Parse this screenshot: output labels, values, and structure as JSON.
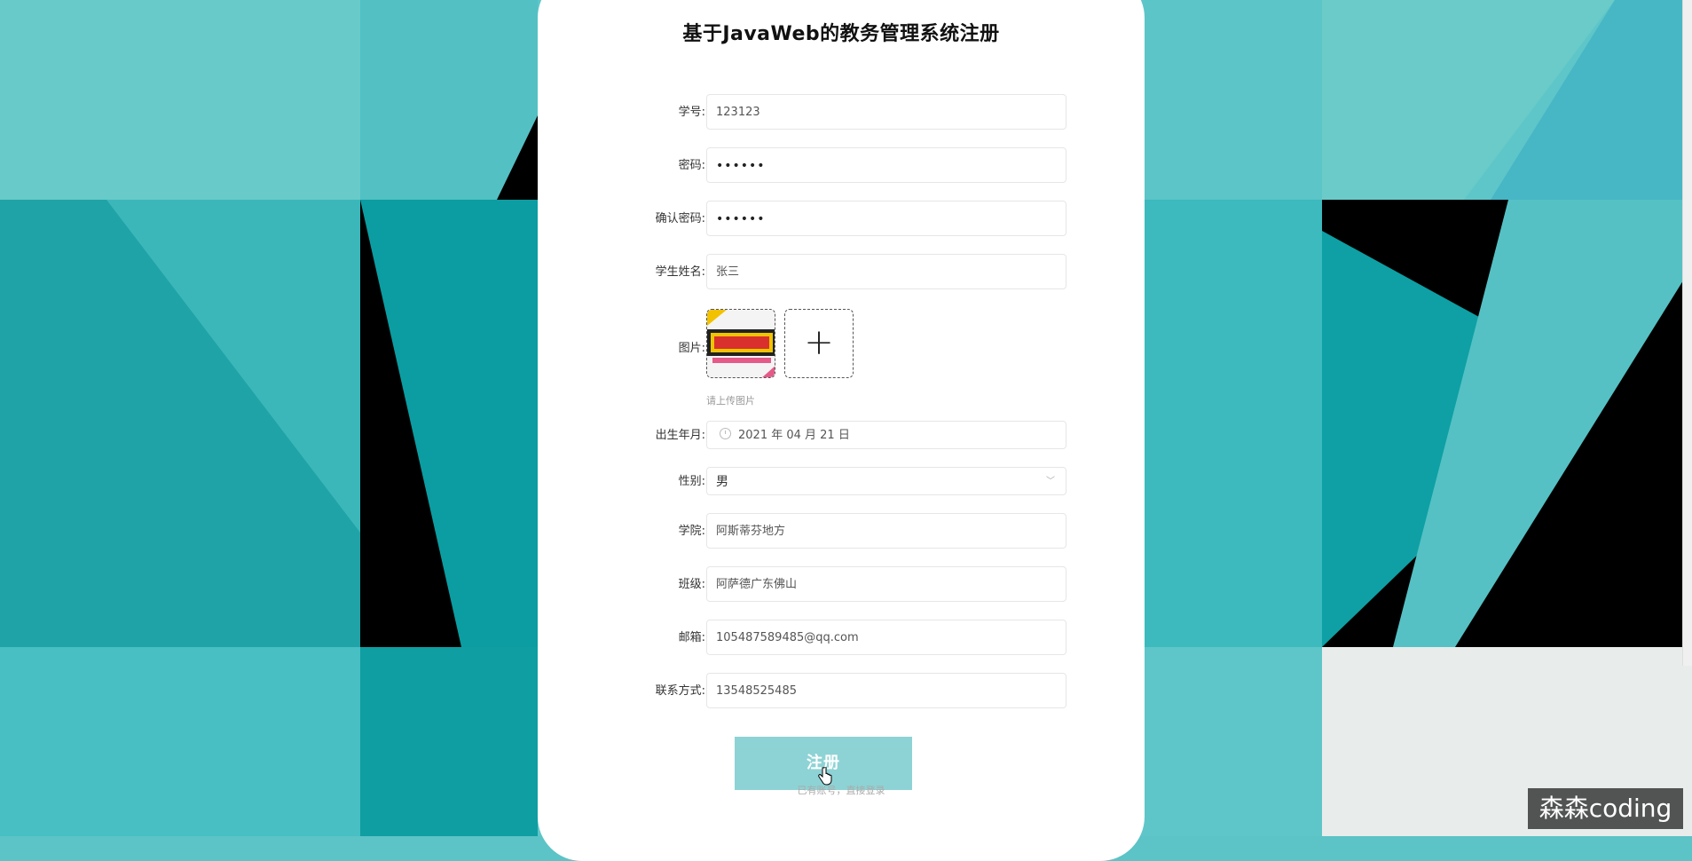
{
  "form": {
    "title": "基于JavaWeb的教务管理系统注册",
    "student_id": {
      "label": "学号:",
      "value": "123123"
    },
    "password": {
      "label": "密码:",
      "value": "••••••"
    },
    "confirm_password": {
      "label": "确认密码:",
      "value": "••••••"
    },
    "student_name": {
      "label": "学生姓名:",
      "value": "张三"
    },
    "image": {
      "label": "图片:",
      "hint": "请上传图片",
      "add_icon": "plus-icon"
    },
    "birth_date": {
      "label": "出生年月:",
      "value": "2021 年 04 月 21 日",
      "icon": "clock-icon"
    },
    "gender": {
      "label": "性别:",
      "value": "男",
      "icon": "chevron-down-icon"
    },
    "college": {
      "label": "学院:",
      "value": "阿斯蒂芬地方"
    },
    "class": {
      "label": "班级:",
      "value": "阿萨德广东佛山"
    },
    "email": {
      "label": "邮箱:",
      "value": "105487589485@qq.com"
    },
    "contact": {
      "label": "联系方式:",
      "value": "13548525485"
    },
    "register_button": "注册",
    "login_link": "已有账号，直接登录"
  },
  "watermark": "森森coding",
  "colors": {
    "background": "#5cc3c6",
    "button": "#8dd3d5",
    "card": "#ffffff"
  }
}
